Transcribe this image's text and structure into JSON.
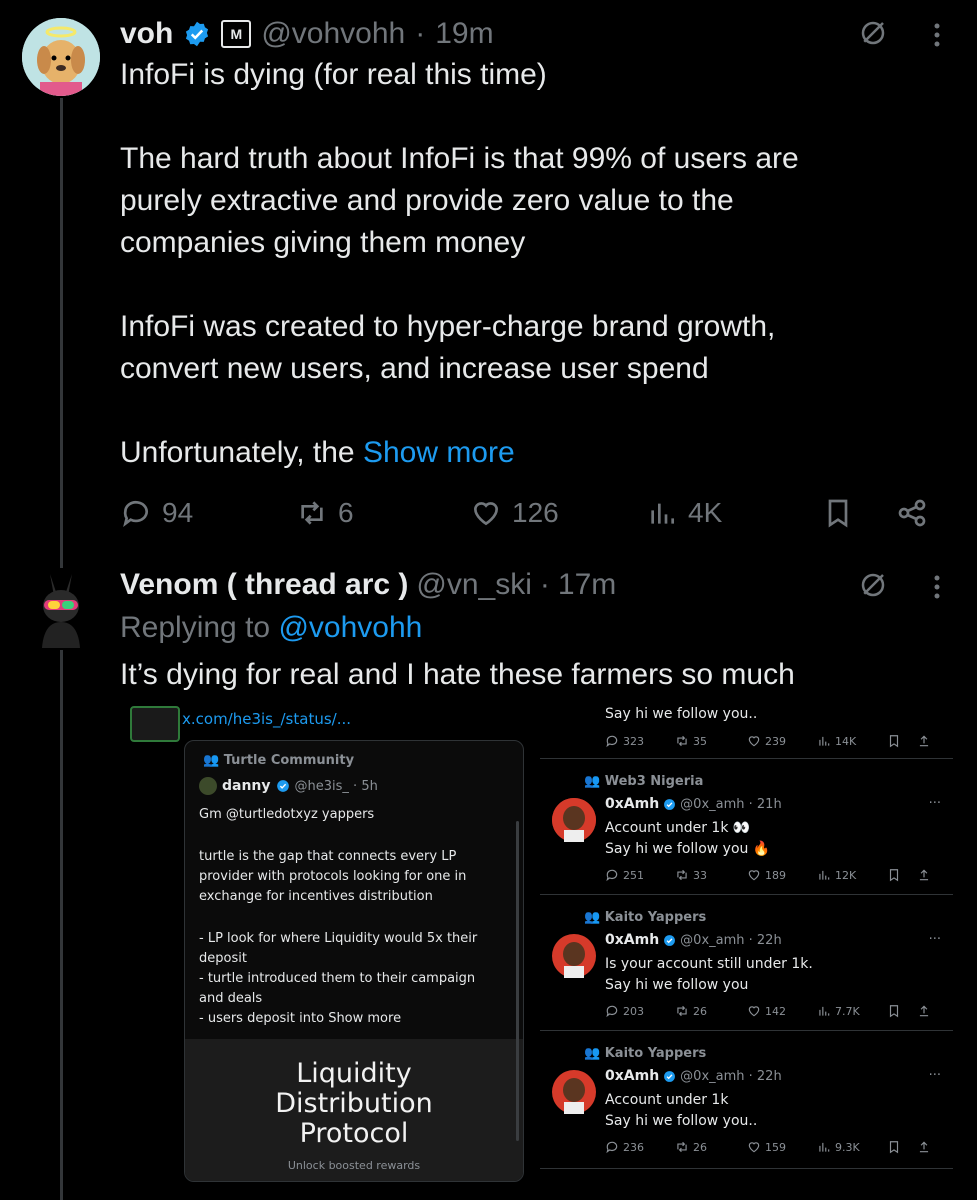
{
  "tweet1": {
    "name": "voh",
    "badge_text": "M",
    "handle": "@vohvohh",
    "time": "19m",
    "lines": [
      "InfoFi is dying (for real this time)",
      "",
      "The hard truth about InfoFi is that 99% of users are",
      "purely extractive and provide zero value to the",
      "companies giving them money",
      "",
      "InfoFi was created to hyper-charge brand growth,",
      "convert new users, and increase user spend",
      "",
      "Unfortunately, the"
    ],
    "show_more": "Show more",
    "replies": "94",
    "reposts": "6",
    "likes": "126",
    "views": "4K"
  },
  "tweet2": {
    "name": "Venom ( thread arc )",
    "handle": "@vn_ski",
    "time": "17m",
    "replying_prefix": "Replying to",
    "replying_to": "@vohvohh",
    "text": "It’s dying for real and I hate these farmers so much"
  },
  "embed": {
    "url": "x.com/he3is_/status/...",
    "card": {
      "community": "Turtle Community",
      "name": "danny",
      "handle": "@he3is_ · 5h",
      "line1": "Gm @turtledotxyz yappers",
      "para": [
        "turtle is the gap that connects every LP",
        "provider with protocols looking for one in",
        "exchange for incentives distribution"
      ],
      "bullets": [
        "- LP look for where Liquidity would 5x their",
        "deposit",
        "- turtle introduced them to their campaign",
        "and deals",
        "- users deposit into Show more"
      ],
      "image_title": [
        "Liquidity",
        "Distribution",
        "Protocol"
      ],
      "image_sub": "Unlock boosted rewards"
    },
    "top_partial": {
      "text": "Say hi we follow you..",
      "stats": [
        "323",
        "35",
        "239",
        "14K"
      ]
    },
    "right_tweets": [
      {
        "community": "Web3 Nigeria",
        "name": "0xAmh",
        "handle": "@0x_amh · 21h",
        "lines": [
          "Account under 1k 👀",
          "Say hi we follow you 🔥"
        ],
        "stats": [
          "251",
          "33",
          "189",
          "12K"
        ]
      },
      {
        "community": "Kaito Yappers",
        "name": "0xAmh",
        "handle": "@0x_amh · 22h",
        "lines": [
          "Is your account still under 1k.",
          "Say hi we follow you"
        ],
        "stats": [
          "203",
          "26",
          "142",
          "7.7K"
        ]
      },
      {
        "community": "Kaito Yappers",
        "name": "0xAmh",
        "handle": "@0x_amh · 22h",
        "lines": [
          "Account under 1k",
          "Say hi we follow you.."
        ],
        "stats": [
          "236",
          "26",
          "159",
          "9.3K"
        ]
      }
    ]
  },
  "colors": {
    "accent": "#1d9bf0",
    "muted": "#71767b",
    "background": "#000000"
  }
}
